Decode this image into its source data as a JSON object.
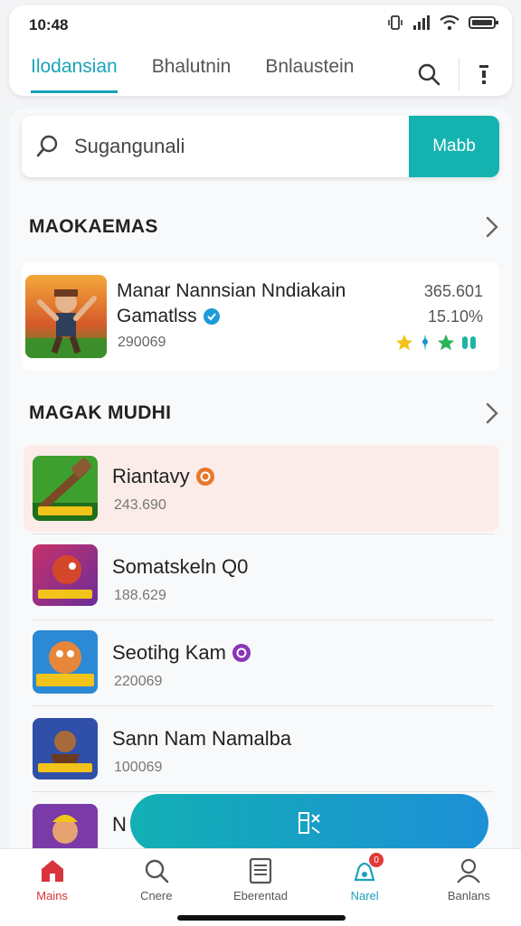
{
  "status": {
    "time": "10:48"
  },
  "tabs": [
    {
      "label": "Ilodansian",
      "active": true
    },
    {
      "label": "Bhalutnin",
      "active": false
    },
    {
      "label": "Bnlaustein",
      "active": false
    }
  ],
  "search": {
    "placeholder": "Sugangunali",
    "button_label": "Mabb"
  },
  "section1": {
    "title": "MAOKAEMAS"
  },
  "featured": {
    "title": "Manar Nannsian Nndiakain",
    "subtitle": "Gamatlss",
    "count": "290069",
    "price": "365.601",
    "percent": "15.10%"
  },
  "section2": {
    "title": "MAGAK MUDHI"
  },
  "list": [
    {
      "title": "Riantavy",
      "count": "243.690",
      "badge_color": "#e8782b"
    },
    {
      "title": "Somatskeln Q0",
      "count": "188.629"
    },
    {
      "title": "Seotihg Kam",
      "count": "220069",
      "badge_color": "#8a35b6"
    },
    {
      "title": "Sann Nam Namalba",
      "count": "100069"
    },
    {
      "title": "N"
    }
  ],
  "fab": {
    "icon": "fab-icon"
  },
  "nav": [
    {
      "label": "Mains",
      "active": true
    },
    {
      "label": "Cnere",
      "active": false
    },
    {
      "label": "Eberentad",
      "active": false
    },
    {
      "label": "Narel",
      "active": false,
      "badge": "0"
    },
    {
      "label": "Banlans",
      "active": false
    }
  ],
  "colors": {
    "accent": "#1aa3b8",
    "primary_button": "#14b3b0",
    "nav_active": "#d9343b",
    "highlight_row": "#fbece9"
  }
}
